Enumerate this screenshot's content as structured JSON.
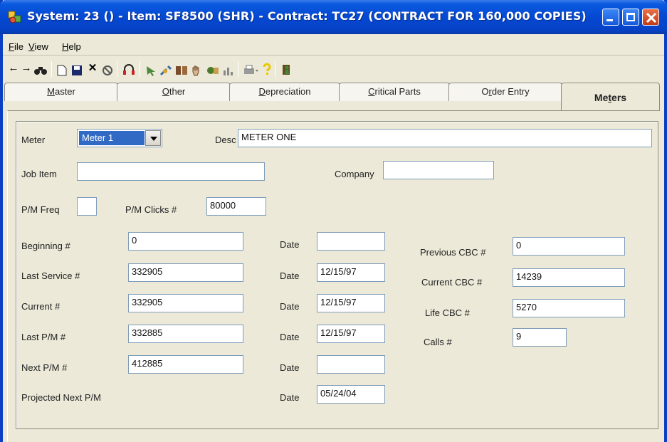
{
  "window": {
    "title": "System: 23 () - Item: SF8500 (SHR) - Contract: TC27 (CONTRACT FOR 160,000 COPIES)",
    "title_color": "#ffffff",
    "titlebar_color": "#0548d2"
  },
  "menu": {
    "file": "File",
    "view": "View",
    "help": "Help"
  },
  "toolbar": {
    "icons": [
      "back-arrow-icon",
      "forward-arrow-icon",
      "binoculars-icon",
      "new-document-icon",
      "save-icon",
      "delete-icon",
      "cancel-icon",
      "headset-icon",
      "pointer-icon",
      "tools-icon",
      "book-icon",
      "hand-icon",
      "parts-icon",
      "chart-icon",
      "printer-icon",
      "help-icon",
      "exit-icon"
    ]
  },
  "tabs": [
    {
      "label": "Master",
      "underline": "M",
      "rest": "aster"
    },
    {
      "label": "Other",
      "underline": "O",
      "rest": "ther"
    },
    {
      "label": "Depreciation",
      "underline": "D",
      "rest": "epreciation"
    },
    {
      "label": "Critical Parts",
      "underline": "C",
      "rest": "ritical Parts"
    },
    {
      "label": "Order Entry",
      "underline": "r",
      "pre": "O",
      "rest": "der Entry"
    },
    {
      "label": "Meters",
      "pre": "Me",
      "underline": "t",
      "rest": "ers"
    }
  ],
  "form": {
    "meter_label": "Meter",
    "meter_value": "Meter 1",
    "desc_label": "Desc",
    "desc_value": "METER ONE",
    "job_item_label": "Job Item",
    "job_item_value": "",
    "company_label": "Company",
    "company_value": "",
    "pm_freq_label": "P/M Freq",
    "pm_freq_value": "",
    "pm_clicks_label": "P/M Clicks #",
    "pm_clicks_value": "80000",
    "beginning_label": "Beginning #",
    "beginning_value": "0",
    "last_service_label": "Last Service #",
    "last_service_value": "332905",
    "current_label": "Current #",
    "current_value": "332905",
    "last_pm_label": "Last P/M #",
    "last_pm_value": "332885",
    "next_pm_label": "Next P/M #",
    "next_pm_value": "412885",
    "projected_label": "Projected Next P/M",
    "date_label": "Date",
    "beginning_date": "",
    "last_service_date": "12/15/97",
    "current_date": "12/15/97",
    "last_pm_date": "12/15/97",
    "next_pm_date": "",
    "projected_date": "05/24/04",
    "prev_cbc_label": "Previous CBC #",
    "prev_cbc_value": "0",
    "current_cbc_label": "Current CBC #",
    "current_cbc_value": "14239",
    "life_cbc_label": "Life CBC #",
    "life_cbc_value": "5270",
    "calls_label": "Calls #",
    "calls_value": "9"
  }
}
